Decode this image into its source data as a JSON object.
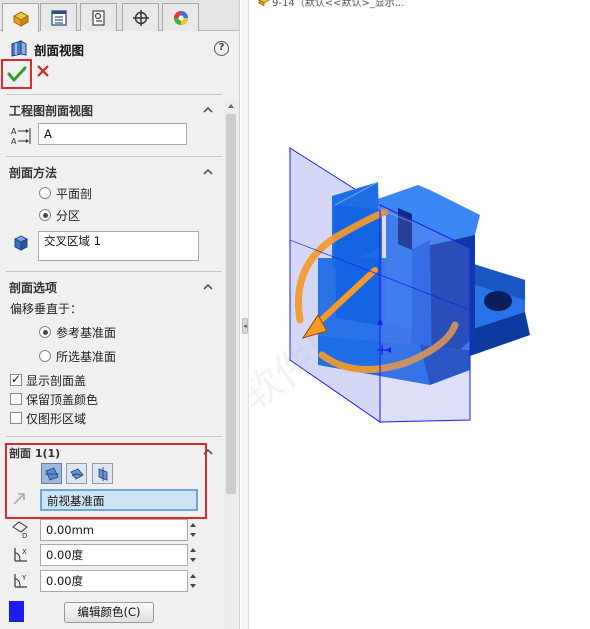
{
  "property_manager": {
    "title": "剖面视图",
    "help_symbol": "?"
  },
  "groups": {
    "drawing_section": {
      "title": "工程图剖面视图",
      "label_value": "A"
    },
    "method": {
      "title": "剖面方法",
      "options": [
        "平面剖",
        "分区"
      ],
      "selected": "分区",
      "region_value": "交叉区域 1"
    },
    "options": {
      "title": "剖面选项",
      "offset_label": "偏移垂直于：",
      "radio_options": [
        "参考基准面",
        "所选基准面"
      ],
      "selected": "参考基准面",
      "checkboxes": [
        {
          "label": "显示剖面盖",
          "checked": true
        },
        {
          "label": "保留顶盖颜色",
          "checked": false
        },
        {
          "label": "仅图形区域",
          "checked": false
        }
      ]
    },
    "section1": {
      "title": "剖面 1(1)",
      "plane_value": "前视基准面",
      "offset_value": "0.00mm",
      "angle_x_value": "0.00度",
      "angle_y_value": "0.00度",
      "edit_color_label": "编辑颜色(C)",
      "color": "#1a1cf2"
    }
  },
  "viewport": {
    "tree_label": "9-14（默认<<默认>_显示..."
  },
  "colors": {
    "highlight_red": "#e02a2a",
    "section_blue": "#1a1cf2",
    "part_blue": "#1e6ee6",
    "arrow_orange": "#f39a2a"
  },
  "icons": {
    "tabs": [
      "feature-manager-icon",
      "property-manager-icon",
      "configuration-manager-icon",
      "dimxpert-icon",
      "display-manager-icon"
    ],
    "ok": "checkmark-icon",
    "cancel": "close-icon"
  }
}
